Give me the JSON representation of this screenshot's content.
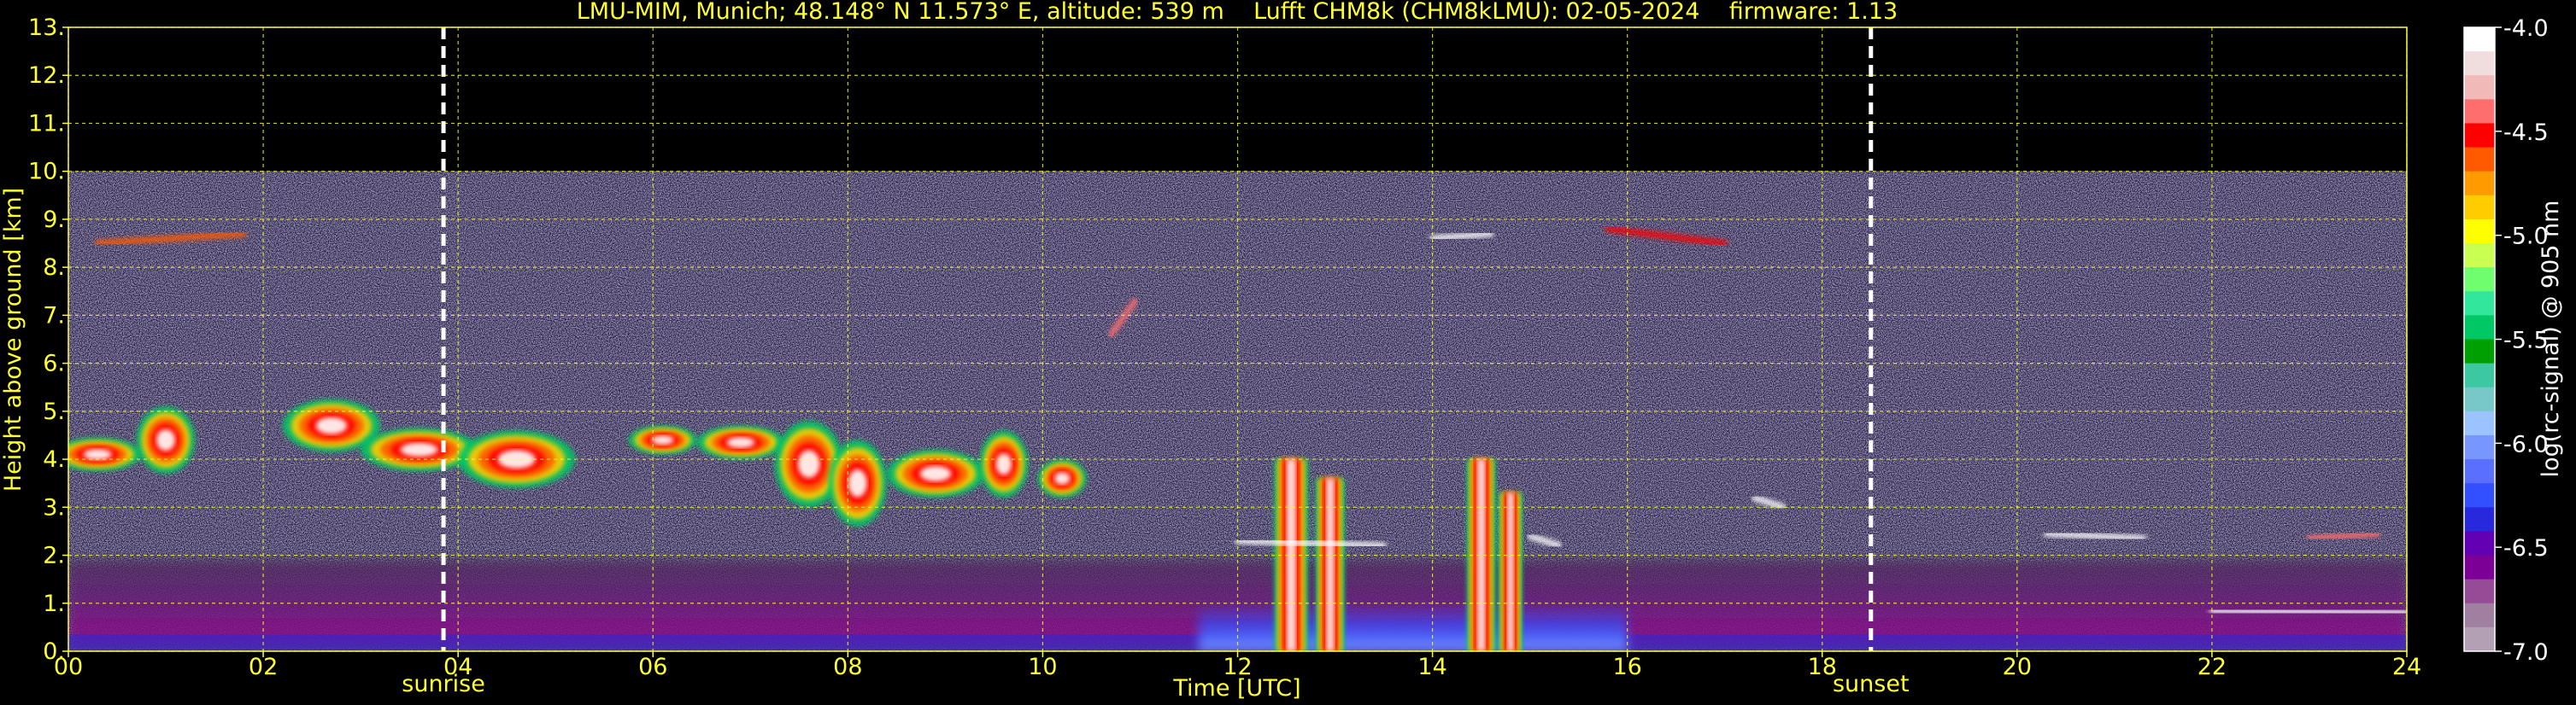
{
  "chart_data": {
    "type": "heatmap",
    "title": "LMU-MIM, Munich; 48.148° N 11.573° E, altitude: 539 m    Lufft CHM8k (CHM8kLMU): 02-05-2024    firmware: 1.13",
    "xlabel": "Time [UTC]",
    "ylabel": "Height above ground [km]",
    "xlim": [
      0,
      24
    ],
    "ylim": [
      0,
      13
    ],
    "x_ticks": [
      "00",
      "02",
      "04",
      "06",
      "08",
      "10",
      "12",
      "14",
      "16",
      "18",
      "20",
      "22",
      "24"
    ],
    "y_ticks": [
      "0.",
      "1.",
      "2.",
      "3.",
      "4.",
      "5.",
      "6.",
      "7.",
      "8.",
      "9.",
      "10.",
      "11.",
      "12.",
      "13."
    ],
    "grid": true,
    "colorbar": {
      "label": "log(rc-signal) @ 905 nm",
      "range": [
        -7.0,
        -4.0
      ],
      "ticks": [
        "-4.0",
        "-4.5",
        "-5.0",
        "-5.5",
        "-6.0",
        "-6.5",
        "-7.0"
      ],
      "colors": [
        "#ffffff",
        "#f0dede",
        "#f2b9b9",
        "#ff6e6e",
        "#ff0000",
        "#ff5a00",
        "#ff9a00",
        "#ffcc00",
        "#ffff00",
        "#c8ff50",
        "#6eff6e",
        "#32e69b",
        "#00c864",
        "#00a000",
        "#3cc8a0",
        "#78c8c8",
        "#9bc3ff",
        "#7896ff",
        "#5a6eff",
        "#3250ff",
        "#2828dc",
        "#6400b4",
        "#7a0096",
        "#964b96",
        "#a080a0",
        "#b4a0b4"
      ]
    },
    "markers": [
      {
        "label": "sunrise",
        "x": 3.85
      },
      {
        "label": "sunset",
        "x": 18.5
      }
    ],
    "features": [
      {
        "name": "instrument data ceiling",
        "ymax": 10.0
      },
      {
        "name": "cloud band",
        "x": [
          0.0,
          10.5
        ],
        "y": [
          2.5,
          5.8
        ]
      },
      {
        "name": "convective cells",
        "x": [
          12.3,
          13.2
        ],
        "y": [
          0.0,
          4.2
        ]
      },
      {
        "name": "convective cells",
        "x": [
          14.3,
          15.0
        ],
        "y": [
          0.0,
          4.0
        ]
      },
      {
        "name": "cirrus",
        "x": [
          0.3,
          1.8
        ],
        "y": [
          8.3,
          8.9
        ]
      },
      {
        "name": "cirrus",
        "x": [
          15.8,
          17.0
        ],
        "y": [
          8.5,
          8.9
        ]
      },
      {
        "name": "boundary layer top",
        "x": [
          22.0,
          24.0
        ],
        "y": [
          0.7,
          0.9
        ]
      },
      {
        "name": "residual cloud",
        "x": [
          20.3,
          21.3
        ],
        "y": [
          2.3,
          2.5
        ]
      },
      {
        "name": "residual cloud",
        "x": [
          23.0,
          23.7
        ],
        "y": [
          2.2,
          2.5
        ]
      }
    ]
  }
}
